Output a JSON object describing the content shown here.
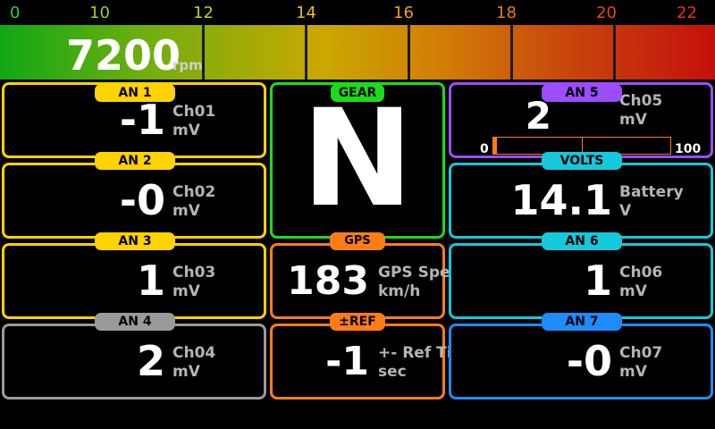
{
  "rpm_scale": [
    "0",
    "10",
    "12",
    "14",
    "16",
    "18",
    "20",
    "22"
  ],
  "rpm": {
    "value": "7200",
    "unit": "rpm"
  },
  "colors": {
    "yellow": "#ffd200",
    "green": "#1adc1a",
    "orange": "#ff7d14",
    "purple": "#9b4dff",
    "cyan": "#15c8dc",
    "gray": "#9a9a9a",
    "blue": "#1e8cff"
  },
  "gear": {
    "tag": "GEAR",
    "value": "N"
  },
  "an1": {
    "tag": "AN 1",
    "value": "-1",
    "name": "Ch01",
    "unit": "mV"
  },
  "an2": {
    "tag": "AN 2",
    "value": "-0",
    "name": "Ch02",
    "unit": "mV"
  },
  "an3": {
    "tag": "AN 3",
    "value": "1",
    "name": "Ch03",
    "unit": "mV"
  },
  "an4": {
    "tag": "AN 4",
    "value": "2",
    "name": "Ch04",
    "unit": "mV"
  },
  "an5": {
    "tag": "AN 5",
    "value": "2",
    "name": "Ch05",
    "unit": "mV",
    "min": "0",
    "max": "100",
    "level": 0.02
  },
  "volts": {
    "tag": "VOLTS",
    "value": "14.1",
    "name": "Battery",
    "unit": "V"
  },
  "an6": {
    "tag": "AN 6",
    "value": "1",
    "name": "Ch06",
    "unit": "mV"
  },
  "an7": {
    "tag": "AN 7",
    "value": "-0",
    "name": "Ch07",
    "unit": "mV"
  },
  "gps": {
    "tag": "GPS SPD",
    "value": "183",
    "name": "GPS Speed",
    "unit": "km/h"
  },
  "ref": {
    "tag": "±REF",
    "value": "-1",
    "name": "+- Ref Time",
    "unit": "sec"
  }
}
